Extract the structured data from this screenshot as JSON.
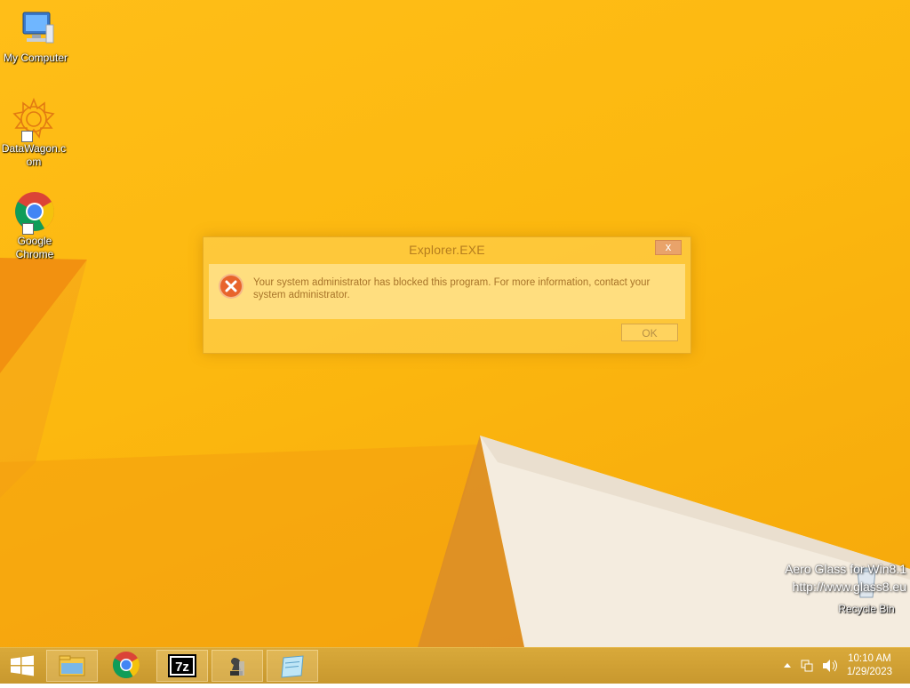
{
  "desktop": {
    "icons": [
      {
        "label": "My Computer",
        "icon": "my-computer-icon"
      },
      {
        "label": "DataWagon.c\nom",
        "icon": "datawagon-icon"
      },
      {
        "label": "Google\nChrome",
        "icon": "chrome-icon"
      },
      {
        "label": "Recycle Bin",
        "icon": "recycle-bin-icon"
      }
    ],
    "watermark": {
      "line1": "Aero Glass for Win8.1",
      "line2": "http://www.glass8.eu"
    }
  },
  "dialog": {
    "title": "Explorer.EXE",
    "close_label": "x",
    "message": "Your system administrator has blocked this program. For more information, contact your system administrator.",
    "ok_label": "OK",
    "icon": "error-icon"
  },
  "taskbar": {
    "start_icon": "windows-logo-icon",
    "pinned": [
      "file-explorer-icon",
      "chrome-icon",
      "7zip-icon",
      "chess-icon",
      "notepad-icon"
    ],
    "tray": {
      "icons": [
        "show-hidden-icons-chevron",
        "network-icon",
        "volume-icon"
      ],
      "time": "10:10 AM",
      "date": "1/29/2023"
    }
  },
  "colors": {
    "wallpaper": "#fcb80f",
    "taskbar": "#c8982e",
    "dialog_text": "#a8742a",
    "error_red": "#e8642c"
  }
}
